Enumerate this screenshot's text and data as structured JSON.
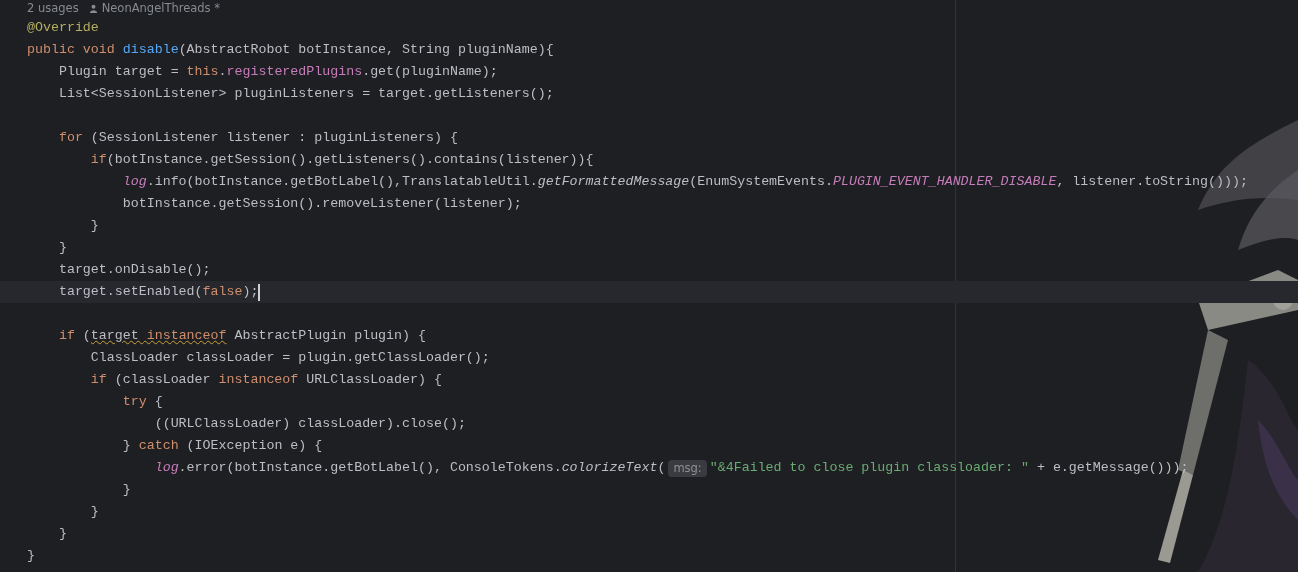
{
  "header": {
    "usages": "2 usages",
    "author": "NeonAngelThreads *"
  },
  "lines": [
    {
      "current": false,
      "tokens": [
        {
          "text": "@Override",
          "kind": "annotation"
        }
      ]
    },
    {
      "current": false,
      "tokens": [
        {
          "text": "public void ",
          "kind": "keyword"
        },
        {
          "text": "disable",
          "kind": "decl"
        },
        {
          "text": "(AbstractRobot botInstance, String pluginName){",
          "kind": "plain"
        }
      ]
    },
    {
      "current": false,
      "tokens": [
        {
          "text": "    Plugin target = ",
          "kind": "plain"
        },
        {
          "text": "this",
          "kind": "keyword"
        },
        {
          "text": ".",
          "kind": "plain"
        },
        {
          "text": "registeredPlugins",
          "kind": "field"
        },
        {
          "text": ".get(pluginName);",
          "kind": "plain"
        }
      ]
    },
    {
      "current": false,
      "tokens": [
        {
          "text": "    List<SessionListener> pluginListeners = target.getListeners();",
          "kind": "plain"
        }
      ]
    },
    {
      "current": false
    },
    {
      "current": false,
      "tokens": [
        {
          "text": "    for",
          "kind": "keyword"
        },
        {
          "text": " (SessionListener listener : pluginListeners) {",
          "kind": "plain"
        }
      ]
    },
    {
      "current": false,
      "tokens": [
        {
          "text": "        if",
          "kind": "keyword"
        },
        {
          "text": "(botInstance.getSession().getListeners().contains(listener)){",
          "kind": "plain"
        }
      ]
    },
    {
      "current": false,
      "tokens": [
        {
          "text": "            log",
          "kind": "static-field"
        },
        {
          "text": ".info(botInstance.getBotLabel(),TranslatableUtil.",
          "kind": "plain"
        },
        {
          "text": "getFormattedMessage",
          "kind": "static-method"
        },
        {
          "text": "(EnumSystemEvents.",
          "kind": "plain"
        },
        {
          "text": "PLUGIN_EVENT_HANDLER_DISABLE",
          "kind": "constant"
        },
        {
          "text": ", listener.toString()));",
          "kind": "plain"
        }
      ]
    },
    {
      "current": false,
      "tokens": [
        {
          "text": "            botInstance.getSession().removeListener(listener);",
          "kind": "plain"
        }
      ]
    },
    {
      "current": false,
      "tokens": [
        {
          "text": "        }",
          "kind": "plain"
        }
      ]
    },
    {
      "current": false,
      "tokens": [
        {
          "text": "    }",
          "kind": "plain"
        }
      ]
    },
    {
      "current": false,
      "tokens": [
        {
          "text": "    target.onDisable();",
          "kind": "plain"
        }
      ]
    },
    {
      "current": true,
      "tokens": [
        {
          "text": "    target.setEnabled(",
          "kind": "plain"
        },
        {
          "text": "false",
          "kind": "keyword"
        },
        {
          "text": ");",
          "kind": "plain"
        }
      ]
    },
    {
      "current": false
    },
    {
      "current": false,
      "tokens": [
        {
          "text": "    if",
          "kind": "keyword"
        },
        {
          "text": " (",
          "kind": "plain"
        },
        {
          "text": "target ",
          "kind": "plain-warn"
        },
        {
          "text": "instanceof",
          "kind": "keyword-warn"
        },
        {
          "text": " AbstractPlugin plugin) {",
          "kind": "plain"
        }
      ]
    },
    {
      "current": false,
      "tokens": [
        {
          "text": "        ClassLoader classLoader = plugin.getClassLoader();",
          "kind": "plain"
        }
      ]
    },
    {
      "current": false,
      "tokens": [
        {
          "text": "        if",
          "kind": "keyword"
        },
        {
          "text": " (classLoader ",
          "kind": "plain"
        },
        {
          "text": "instanceof",
          "kind": "keyword"
        },
        {
          "text": " URLClassLoader) {",
          "kind": "plain"
        }
      ]
    },
    {
      "current": false,
      "tokens": [
        {
          "text": "            try",
          "kind": "keyword"
        },
        {
          "text": " {",
          "kind": "plain"
        }
      ]
    },
    {
      "current": false,
      "tokens": [
        {
          "text": "                ((URLClassLoader) classLoader).close();",
          "kind": "plain"
        }
      ]
    },
    {
      "current": false,
      "tokens": [
        {
          "text": "            } ",
          "kind": "plain"
        },
        {
          "text": "catch",
          "kind": "keyword"
        },
        {
          "text": " (IOException e) {",
          "kind": "plain"
        }
      ]
    },
    {
      "current": false,
      "tokens": [
        {
          "text": "                log",
          "kind": "static-field"
        },
        {
          "text": ".error(botInstance.getBotLabel(), ConsoleTokens.",
          "kind": "plain"
        },
        {
          "text": "colorizeText",
          "kind": "static-method"
        },
        {
          "text": "(",
          "kind": "plain"
        },
        {
          "text": "msg:",
          "kind": "hint"
        },
        {
          "text": "\"&4Failed to close plugin classloader: \"",
          "kind": "string"
        },
        {
          "text": " + e.getMessage()));",
          "kind": "plain"
        }
      ]
    },
    {
      "current": false,
      "tokens": [
        {
          "text": "            }",
          "kind": "plain"
        }
      ]
    },
    {
      "current": false,
      "tokens": [
        {
          "text": "        }",
          "kind": "plain"
        }
      ]
    },
    {
      "current": false,
      "tokens": [
        {
          "text": "    }",
          "kind": "plain"
        }
      ]
    },
    {
      "current": false,
      "tokens": [
        {
          "text": "}",
          "kind": "plain"
        }
      ]
    }
  ]
}
